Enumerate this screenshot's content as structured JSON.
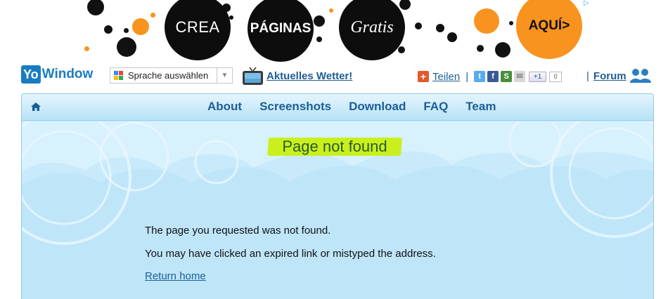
{
  "ad": {
    "word1": "CREA",
    "word2": "PÁGINAS",
    "word3": "Gratis",
    "word4": "AQUÍ>",
    "colors": {
      "black": "#0d0d0d",
      "orange": "#f7931e"
    }
  },
  "header": {
    "logo_yo": "Yo",
    "logo_window": "Window",
    "language_select": "Sprache auswählen",
    "weather_link": "Aktuelles Wetter!",
    "share_label": "Teilen",
    "share_separator": "|",
    "plusone_label": "+1",
    "plusone_count": "0",
    "forum_separator": "|",
    "forum_label": "Forum"
  },
  "nav": {
    "items": [
      {
        "label": "About"
      },
      {
        "label": "Screenshots"
      },
      {
        "label": "Download"
      },
      {
        "label": "FAQ"
      },
      {
        "label": "Team"
      }
    ]
  },
  "content": {
    "title": "Page not found",
    "message1": "The page you requested was not found.",
    "message2": "You may have clicked an expired link or mistyped the address.",
    "return_link": "Return home"
  },
  "colors": {
    "brand": "#1a7cc0",
    "link": "#1d5e96",
    "highlight": "#c9f01e",
    "sky": "#c5e8fa"
  }
}
